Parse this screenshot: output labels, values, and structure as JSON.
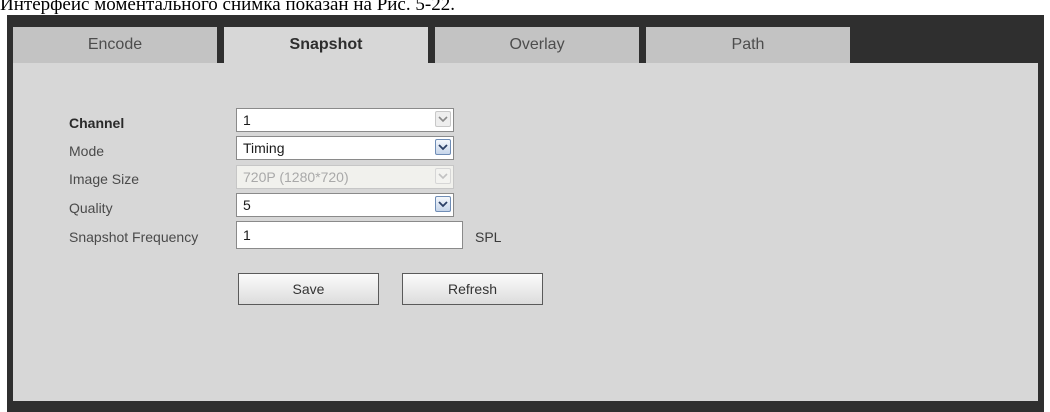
{
  "caption": "Интерфейс моментального снимка показан на Рис. 5-22.",
  "tabs": [
    {
      "label": "Encode",
      "active": false
    },
    {
      "label": "Snapshot",
      "active": true
    },
    {
      "label": "Overlay",
      "active": false
    },
    {
      "label": "Path",
      "active": false
    }
  ],
  "form": {
    "channel": {
      "label": "Channel",
      "value": "1"
    },
    "mode": {
      "label": "Mode",
      "value": "Timing"
    },
    "image_size": {
      "label": "Image Size",
      "value": "720P (1280*720)",
      "disabled": true
    },
    "quality": {
      "label": "Quality",
      "value": "5"
    },
    "frequency": {
      "label": "Snapshot Frequency",
      "value": "1",
      "unit": "SPL"
    }
  },
  "buttons": {
    "save": "Save",
    "refresh": "Refresh"
  },
  "icons": {
    "dropdown": "chevron-down-icon"
  },
  "colors": {
    "panel": "#d7d7d7",
    "tab_inactive": "#c3c3c3",
    "frame": "#2f2f2f"
  }
}
